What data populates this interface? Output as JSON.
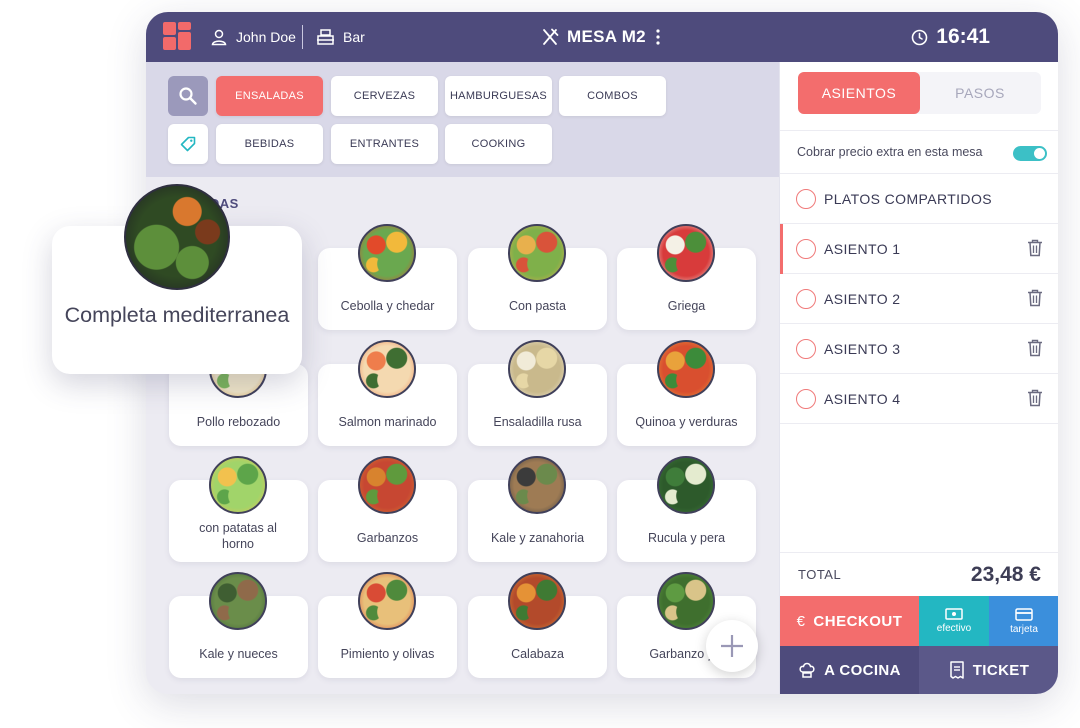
{
  "header": {
    "user": "John Doe",
    "location": "Bar",
    "table": "MESA M2",
    "time": "16:41"
  },
  "categories": {
    "row1": [
      "ENSALADAS",
      "CERVEZAS",
      "HAMBURGUESAS",
      "COMBOS"
    ],
    "row2": [
      "BEBIDAS",
      "ENTRANTES",
      "COOKING"
    ],
    "active": "ENSALADAS"
  },
  "section_title": "ADAS",
  "products": [
    {
      "name": "Cebolla y chedar",
      "colors": [
        "#e24a2a",
        "#f2b93b",
        "#6aa84f"
      ]
    },
    {
      "name": "Con pasta",
      "colors": [
        "#e8b04d",
        "#d9533a",
        "#7fb04a"
      ]
    },
    {
      "name": "Griega",
      "colors": [
        "#f4f1e6",
        "#4c8f3a",
        "#d83b3b"
      ]
    },
    {
      "name": "Pollo rebozado",
      "colors": [
        "#d9a651",
        "#7bb65a",
        "#f0e6c8"
      ]
    },
    {
      "name": "Salmon marinado",
      "colors": [
        "#ef7d4c",
        "#3f6e32",
        "#f4d9b0"
      ]
    },
    {
      "name": "Ensaladilla rusa",
      "colors": [
        "#f1ebd8",
        "#e6d7a6",
        "#c9b98c"
      ]
    },
    {
      "name": "Quinoa y verduras",
      "colors": [
        "#e9a23b",
        "#3c8b3a",
        "#d94f2f"
      ]
    },
    {
      "name": "con patatas al horno",
      "colors": [
        "#f2c14e",
        "#5da54a",
        "#a1d46a"
      ]
    },
    {
      "name": "Garbanzos",
      "colors": [
        "#d8832e",
        "#5f9a3d",
        "#c74732"
      ]
    },
    {
      "name": "Kale y zanahoria",
      "colors": [
        "#3b3b3b",
        "#6b8a4c",
        "#9e7b54"
      ]
    },
    {
      "name": "Rucula y pera",
      "colors": [
        "#3f7d3a",
        "#e4ebcf",
        "#2d5a2b"
      ]
    },
    {
      "name": "Kale y nueces",
      "colors": [
        "#3f5e32",
        "#8f6a4a",
        "#6a8d4a"
      ]
    },
    {
      "name": "Pimiento y olivas",
      "colors": [
        "#d94b35",
        "#4f8a3c",
        "#e8c07a"
      ]
    },
    {
      "name": "Calabaza",
      "colors": [
        "#e59236",
        "#3f7a33",
        "#b34a2b"
      ]
    },
    {
      "name": "Garbanzo y c",
      "colors": [
        "#5e9b42",
        "#d9c489",
        "#3f6f2e"
      ]
    }
  ],
  "popup": {
    "name": "Completa mediterranea",
    "colors": [
      "#7a3a1c",
      "#d9782e",
      "#5d8f3b",
      "#2f4a23"
    ]
  },
  "right_panel": {
    "tabs": [
      "ASIENTOS",
      "PASOS"
    ],
    "extra_price_label": "Cobrar precio extra en esta mesa",
    "extra_price_enabled": true,
    "shared": "PLATOS COMPARTIDOS",
    "seats": [
      "ASIENTO 1",
      "ASIENTO 2",
      "ASIENTO 3",
      "ASIENTO 4"
    ],
    "selected_seat": "ASIENTO 1",
    "total_label": "TOTAL",
    "total_value": "23,48 €",
    "checkout": "CHECKOUT",
    "efectivo": "efectivo",
    "tarjeta": "tarjeta",
    "cocina": "A COCINA",
    "ticket": "TICKET"
  },
  "colors": {
    "accent": "#f36d6d",
    "header": "#4e4b7c",
    "teal": "#23b7c2",
    "blue": "#3b8fdc"
  }
}
